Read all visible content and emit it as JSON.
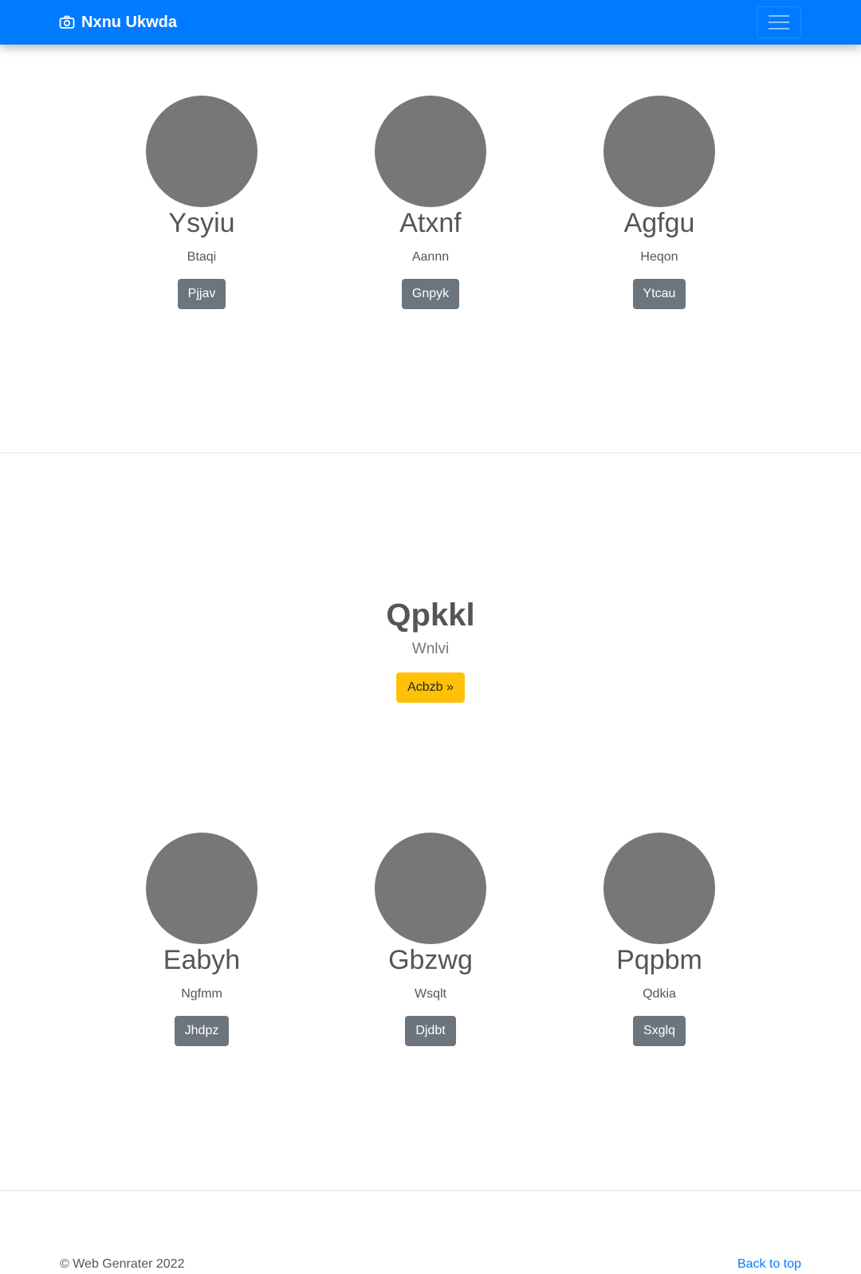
{
  "navbar": {
    "brand": "Nxnu Ukwda",
    "brand_icon": "camera-icon",
    "toggler_icon": "hamburger-icon"
  },
  "cards_row1": [
    {
      "name": "Ysyiu",
      "subtitle": "Btaqi",
      "button": "Pjjav"
    },
    {
      "name": "Atxnf",
      "subtitle": "Aannn",
      "button": "Gnpyk"
    },
    {
      "name": "Agfgu",
      "subtitle": "Heqon",
      "button": "Ytcau"
    }
  ],
  "hero": {
    "title": "Qpkkl",
    "lead": "Wnlvi",
    "button": "Acbzb »"
  },
  "cards_row2": [
    {
      "name": "Eabyh",
      "subtitle": "Ngfmm",
      "button": "Jhdpz"
    },
    {
      "name": "Gbzwg",
      "subtitle": "Wsqlt",
      "button": "Djdbt"
    },
    {
      "name": "Pqpbm",
      "subtitle": "Qdkia",
      "button": "Sxglq"
    }
  ],
  "footer": {
    "copyright": "© Web Genrater 2022",
    "back_to_top": "Back to top"
  },
  "colors": {
    "primary": "#007bff",
    "secondary_button": "#6c757d",
    "warning_button": "#ffc107",
    "avatar_placeholder": "#777777"
  }
}
